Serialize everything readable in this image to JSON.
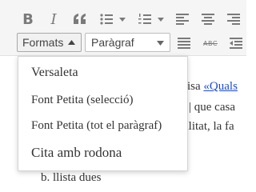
{
  "toolbar": {
    "icons": {
      "bold": "B",
      "italic": "I",
      "blockquote": "quote-icon",
      "bullet_list": "bullet-list-icon",
      "numbered_list": "numbered-list-icon",
      "align_left": "align-left-icon",
      "align_center": "align-center-icon",
      "align_right": "align-right-icon",
      "justify": "justify-icon",
      "strikethrough": "ABC",
      "outdent": "outdent-icon"
    },
    "formats_label": "Formats",
    "paragraph_value": "Paràgraf"
  },
  "formats_menu": {
    "items": [
      {
        "label": "Versaleta"
      },
      {
        "label": "Font Petita (selecció)"
      },
      {
        "label": "Font Petita (tot el paràgraf)"
      },
      {
        "label": "Cita amb rodona"
      }
    ]
  },
  "editor": {
    "line1_text": "Bisa ",
    "line1_link": "«Quals",
    "line2": "| que casa",
    "line3": "alitat, la fa",
    "list_item": "b. llista dues"
  }
}
